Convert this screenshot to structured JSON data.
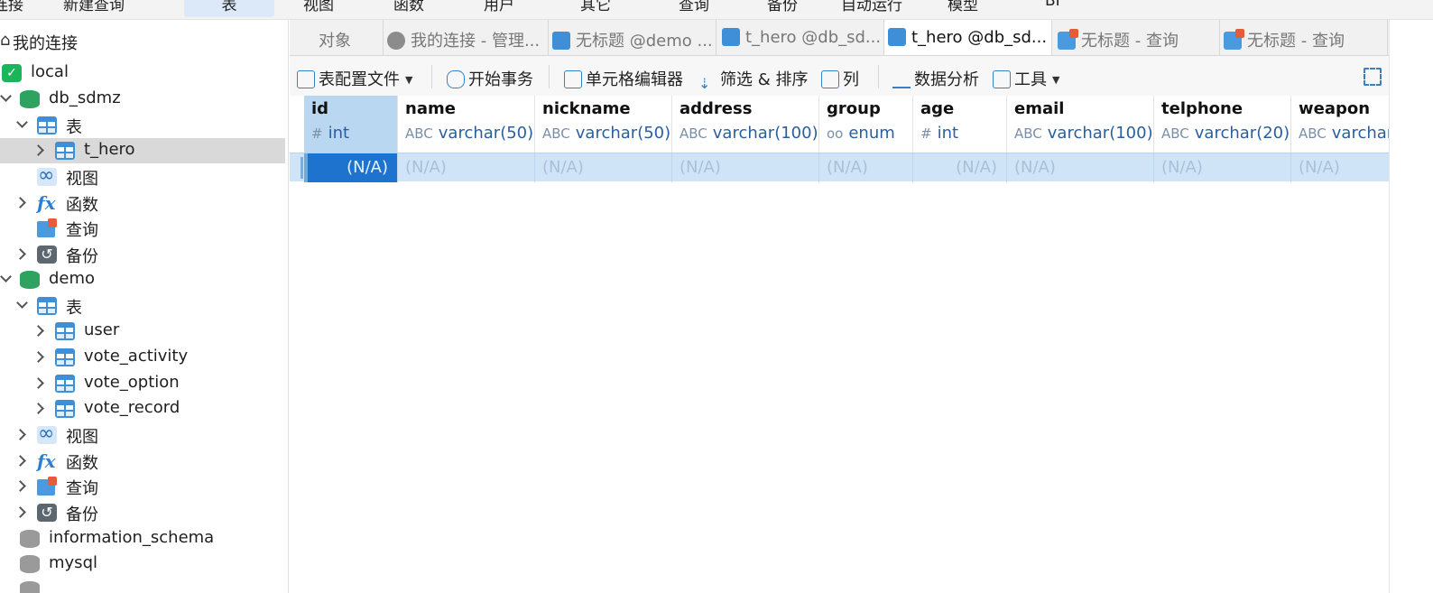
{
  "ribbon": {
    "items": [
      "连接",
      "新建查询",
      "表",
      "视图",
      "函数",
      "用户",
      "其它",
      "查询",
      "备份",
      "自动运行",
      "模型",
      "BI"
    ],
    "active_index": 2
  },
  "sidebar": {
    "header": "我的连接",
    "connection": "local",
    "nodes": [
      {
        "label": "db_sdmz"
      },
      {
        "label": "表"
      },
      {
        "label": "t_hero"
      },
      {
        "label": "视图"
      },
      {
        "label": "函数"
      },
      {
        "label": "查询"
      },
      {
        "label": "备份"
      },
      {
        "label": "demo"
      },
      {
        "label": "表"
      },
      {
        "label": "user"
      },
      {
        "label": "vote_activity"
      },
      {
        "label": "vote_option"
      },
      {
        "label": "vote_record"
      },
      {
        "label": "视图"
      },
      {
        "label": "函数"
      },
      {
        "label": "查询"
      },
      {
        "label": "备份"
      },
      {
        "label": "information_schema"
      },
      {
        "label": "mysql"
      }
    ]
  },
  "tabs": [
    {
      "label": "对象"
    },
    {
      "label": "我的连接 - 管理..."
    },
    {
      "label": "无标题 @demo ..."
    },
    {
      "label": "t_hero @db_sd..."
    },
    {
      "label": "t_hero @db_sd..."
    },
    {
      "label": "无标题 - 查询"
    },
    {
      "label": "无标题 - 查询"
    }
  ],
  "toolbar": {
    "profile": "表配置文件",
    "begin_transaction": "开始事务",
    "cell_editor": "单元格编辑器",
    "filter_sort": "筛选 & 排序",
    "columns": "列",
    "data_analysis": "数据分析",
    "tools": "工具"
  },
  "grid": {
    "columns": [
      {
        "name": "id",
        "type": "int",
        "glyph": "#"
      },
      {
        "name": "name",
        "type": "varchar(50)",
        "glyph": "ABC"
      },
      {
        "name": "nickname",
        "type": "varchar(50)",
        "glyph": "ABC"
      },
      {
        "name": "address",
        "type": "varchar(100)",
        "glyph": "ABC"
      },
      {
        "name": "group",
        "type": "enum",
        "glyph": "oo"
      },
      {
        "name": "age",
        "type": "int",
        "glyph": "#"
      },
      {
        "name": "email",
        "type": "varchar(100)",
        "glyph": "ABC"
      },
      {
        "name": "telphone",
        "type": "varchar(20)",
        "glyph": "ABC"
      },
      {
        "name": "weapon",
        "type": "varchar(",
        "glyph": "ABC"
      }
    ],
    "row": [
      "(N/A)",
      "(N/A)",
      "(N/A)",
      "(N/A)",
      "(N/A)",
      "(N/A)",
      "(N/A)",
      "(N/A)",
      "(N/A)"
    ]
  }
}
